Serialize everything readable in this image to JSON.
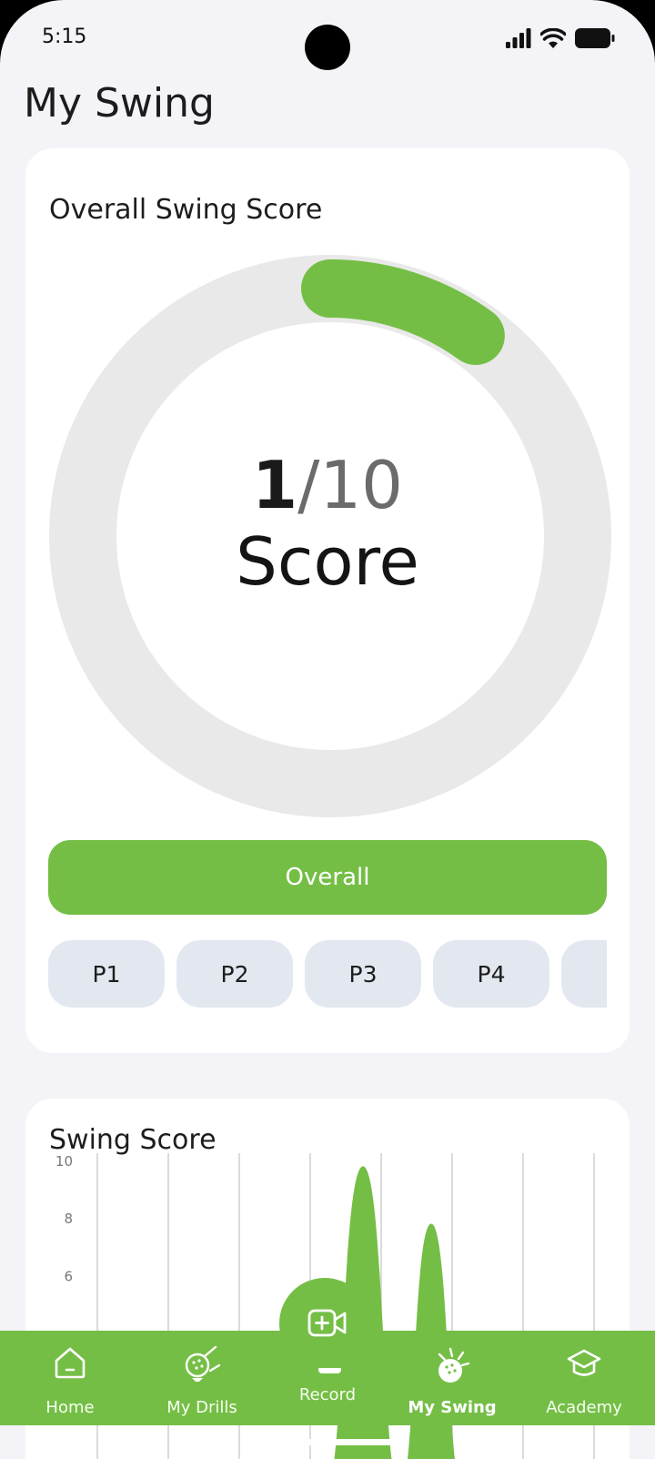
{
  "status_bar": {
    "time": "5:15",
    "icons": [
      "signal-icon",
      "wifi-icon",
      "battery-icon"
    ]
  },
  "page": {
    "title": "My Swing"
  },
  "score_card": {
    "title": "Overall Swing Score",
    "score_value": "1",
    "score_denominator": "/10",
    "score_word": "Score",
    "progress_fraction": 0.1,
    "progress_color": "#75be46",
    "track_color": "#e9e9e9",
    "overall_button": "Overall",
    "phase_chips": [
      "P1",
      "P2",
      "P3",
      "P4",
      ""
    ]
  },
  "chart_card": {
    "title": "Swing Score",
    "chart_data": {
      "type": "area",
      "y_ticks": [
        "10",
        "8",
        "6"
      ],
      "ylim": [
        0,
        10
      ],
      "grid": true,
      "color": "#75be46",
      "peaks": [
        {
          "y": 9.8
        },
        {
          "y": 7.8
        }
      ]
    }
  },
  "nav": {
    "accent": "#75be46",
    "items": [
      {
        "label": "Home",
        "icon": "home-icon"
      },
      {
        "label": "My Drills",
        "icon": "golf-drills-icon"
      },
      {
        "label": "Record",
        "icon": "record-video-icon"
      },
      {
        "label": "My Swing",
        "icon": "golf-swing-icon"
      },
      {
        "label": "Academy",
        "icon": "graduation-cap-icon"
      }
    ],
    "active": "My Swing"
  }
}
